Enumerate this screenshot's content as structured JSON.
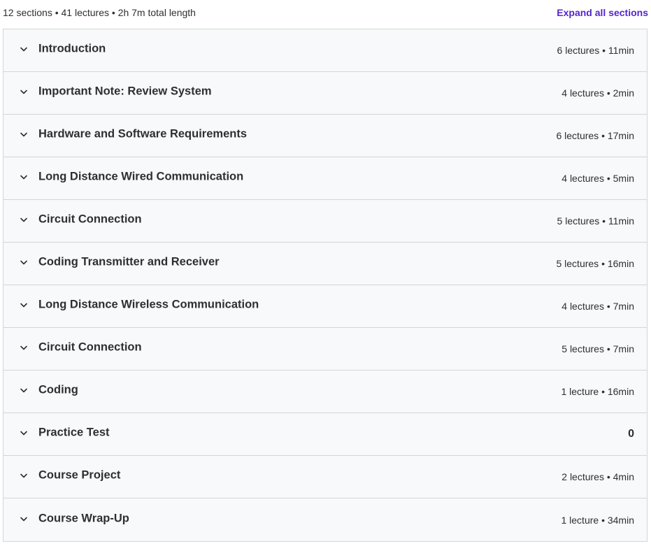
{
  "summary": {
    "text": "12 sections • 41 lectures • 2h 7m total length",
    "expand_label": "Expand all sections"
  },
  "colors": {
    "accent": "#5624d0",
    "row_background": "#f7f9fa",
    "border": "#d1d7dc",
    "text": "#2d2f31"
  },
  "sections": [
    {
      "title": "Introduction",
      "meta": "6 lectures • 11min",
      "icon": "chevron-down-icon"
    },
    {
      "title": "Important Note: Review System",
      "meta": "4 lectures • 2min",
      "icon": "chevron-down-icon"
    },
    {
      "title": "Hardware and Software Requirements",
      "meta": "6 lectures • 17min",
      "icon": "chevron-down-icon"
    },
    {
      "title": "Long Distance Wired Communication",
      "meta": "4 lectures • 5min",
      "icon": "chevron-down-icon"
    },
    {
      "title": "Circuit Connection",
      "meta": "5 lectures • 11min",
      "icon": "chevron-down-icon"
    },
    {
      "title": "Coding Transmitter and Receiver",
      "meta": "5 lectures • 16min",
      "icon": "chevron-down-icon"
    },
    {
      "title": "Long Distance Wireless Communication",
      "meta": "4 lectures • 7min",
      "icon": "chevron-down-icon"
    },
    {
      "title": "Circuit Connection",
      "meta": "5 lectures • 7min",
      "icon": "chevron-down-icon"
    },
    {
      "title": "Coding",
      "meta": "1 lecture • 16min",
      "icon": "chevron-down-icon"
    },
    {
      "title": "Practice Test",
      "meta": "0",
      "icon": "chevron-down-icon"
    },
    {
      "title": "Course Project",
      "meta": "2 lectures • 4min",
      "icon": "chevron-down-icon"
    },
    {
      "title": "Course Wrap-Up",
      "meta": "1 lecture • 34min",
      "icon": "chevron-down-icon"
    }
  ]
}
